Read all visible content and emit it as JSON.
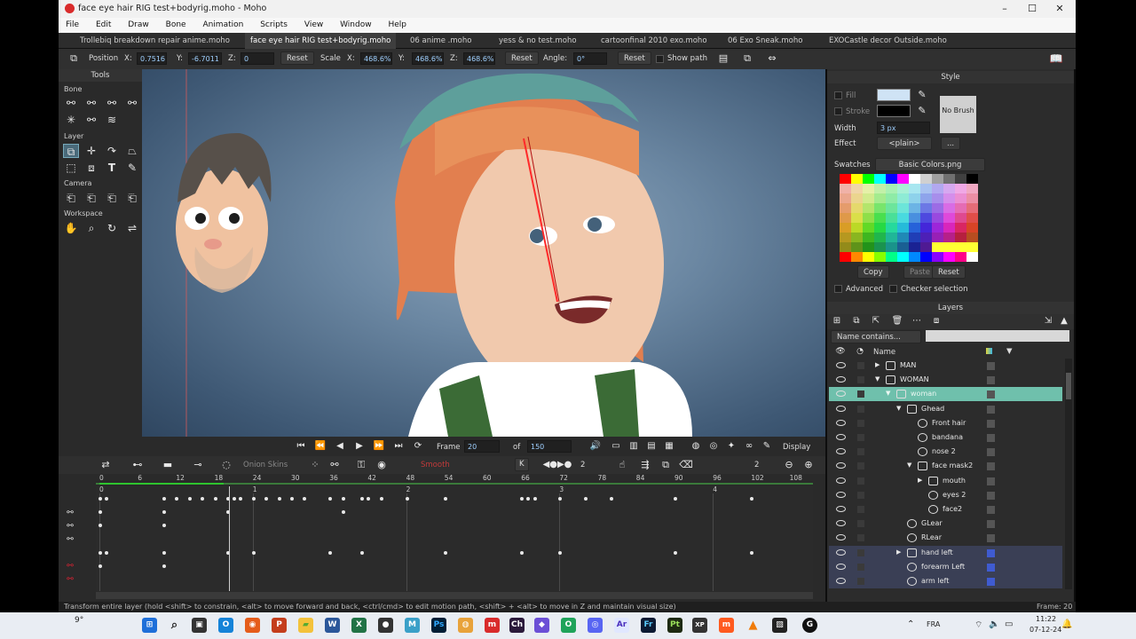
{
  "window": {
    "title": "face eye hair RIG test+bodyrig.moho - Moho",
    "minimize": "–",
    "maximize": "☐",
    "close": "✕"
  },
  "menu": [
    "File",
    "Edit",
    "Draw",
    "Bone",
    "Animation",
    "Scripts",
    "View",
    "Window",
    "Help"
  ],
  "tabs": [
    {
      "label": "Trollebiq breakdown repair anime.moho",
      "active": false
    },
    {
      "label": "face eye hair RIG test+bodyrig.moho",
      "active": true
    },
    {
      "label": "06 anime .moho",
      "active": false
    },
    {
      "label": "yess & no test.moho",
      "active": false
    },
    {
      "label": "cartoonfinal 2010 exo.moho",
      "active": false
    },
    {
      "label": "06 Exo Sneak.moho",
      "active": false
    },
    {
      "label": "EXOCastle decor Outside.moho",
      "active": false
    }
  ],
  "toolopts": {
    "position_label": "Position",
    "x_label": "X:",
    "pos_x": "0.7516",
    "y_label": "Y:",
    "pos_y": "-6.7011",
    "z_label": "Z:",
    "pos_z": "0",
    "reset1": "Reset",
    "scale_label": "Scale",
    "scale_x": "468.6%",
    "scale_y": "468.6%",
    "scale_z": "468.6%",
    "reset2": "Reset",
    "angle_label": "Angle:",
    "angle": "0°",
    "reset3": "Reset",
    "show_path": "Show path"
  },
  "tools": {
    "title": "Tools",
    "sections": {
      "bone": "Bone",
      "layer": "Layer",
      "camera": "Camera",
      "workspace": "Workspace"
    }
  },
  "playback": {
    "frame_label": "Frame",
    "frame": "20",
    "of_label": "of",
    "total": "150",
    "display": "Display"
  },
  "timeline": {
    "onion_skins": "Onion Skins",
    "interp": "Smooth",
    "k": "K",
    "steps": "2",
    "zoom": "2",
    "ruler": [
      "0",
      "6",
      "12",
      "18",
      "24",
      "30",
      "36",
      "42",
      "48",
      "54",
      "60",
      "66",
      "72",
      "78",
      "84",
      "90",
      "96",
      "102",
      "108"
    ],
    "seconds": [
      "0",
      "1",
      "2",
      "3",
      "4"
    ],
    "current_frame": 20
  },
  "style": {
    "title": "Style",
    "fill_label": "Fill",
    "stroke_label": "Stroke",
    "width_label": "Width",
    "width": "3 px",
    "effect_label": "Effect",
    "effect": "<plain>",
    "effect_more": "...",
    "no_brush": "No Brush",
    "swatches_label": "Swatches",
    "swatches": "Basic Colors.png",
    "copy": "Copy",
    "paste": "Paste",
    "reset": "Reset",
    "advanced": "Advanced",
    "checker": "Checker selection",
    "fill_color": "#cfe3f5",
    "stroke_color": "#000000"
  },
  "layers": {
    "title": "Layers",
    "filter": "Name contains...",
    "name_header": "Name",
    "rows": [
      {
        "name": "MAN",
        "indent": 0,
        "type": "folder",
        "style": "normal"
      },
      {
        "name": "WOMAN",
        "indent": 0,
        "type": "folder",
        "style": "normal"
      },
      {
        "name": "woman",
        "indent": 1,
        "type": "bone",
        "style": "sel"
      },
      {
        "name": "Ghead",
        "indent": 2,
        "type": "folder",
        "style": "normal"
      },
      {
        "name": "Front hair",
        "indent": 3,
        "type": "vector",
        "style": "normal"
      },
      {
        "name": "bandana",
        "indent": 3,
        "type": "vector",
        "style": "normal"
      },
      {
        "name": "nose 2",
        "indent": 3,
        "type": "vector",
        "style": "normal"
      },
      {
        "name": "face mask2",
        "indent": 3,
        "type": "group",
        "style": "normal"
      },
      {
        "name": "mouth",
        "indent": 4,
        "type": "switch",
        "style": "normal"
      },
      {
        "name": "eyes 2",
        "indent": 4,
        "type": "vector",
        "style": "normal"
      },
      {
        "name": "face2",
        "indent": 4,
        "type": "vector",
        "style": "normal"
      },
      {
        "name": "GLear",
        "indent": 2,
        "type": "vector",
        "style": "normal"
      },
      {
        "name": "RLear",
        "indent": 2,
        "type": "vector",
        "style": "normal"
      },
      {
        "name": "hand left",
        "indent": 2,
        "type": "switch",
        "style": "blue"
      },
      {
        "name": "forearm Left",
        "indent": 2,
        "type": "vector",
        "style": "blue"
      },
      {
        "name": "arm left",
        "indent": 2,
        "type": "vector",
        "style": "blue"
      }
    ]
  },
  "status": {
    "hint": "Transform entire layer (hold <shift> to constrain, <alt> to move forward and back, <ctrl/cmd> to edit motion path, <shift> + <alt> to move in Z and maintain visual size)",
    "frame": "Frame: 20"
  },
  "taskbar": {
    "weather": "9°",
    "lang": "FRA",
    "time": "11:22",
    "date": "07-12-24"
  }
}
